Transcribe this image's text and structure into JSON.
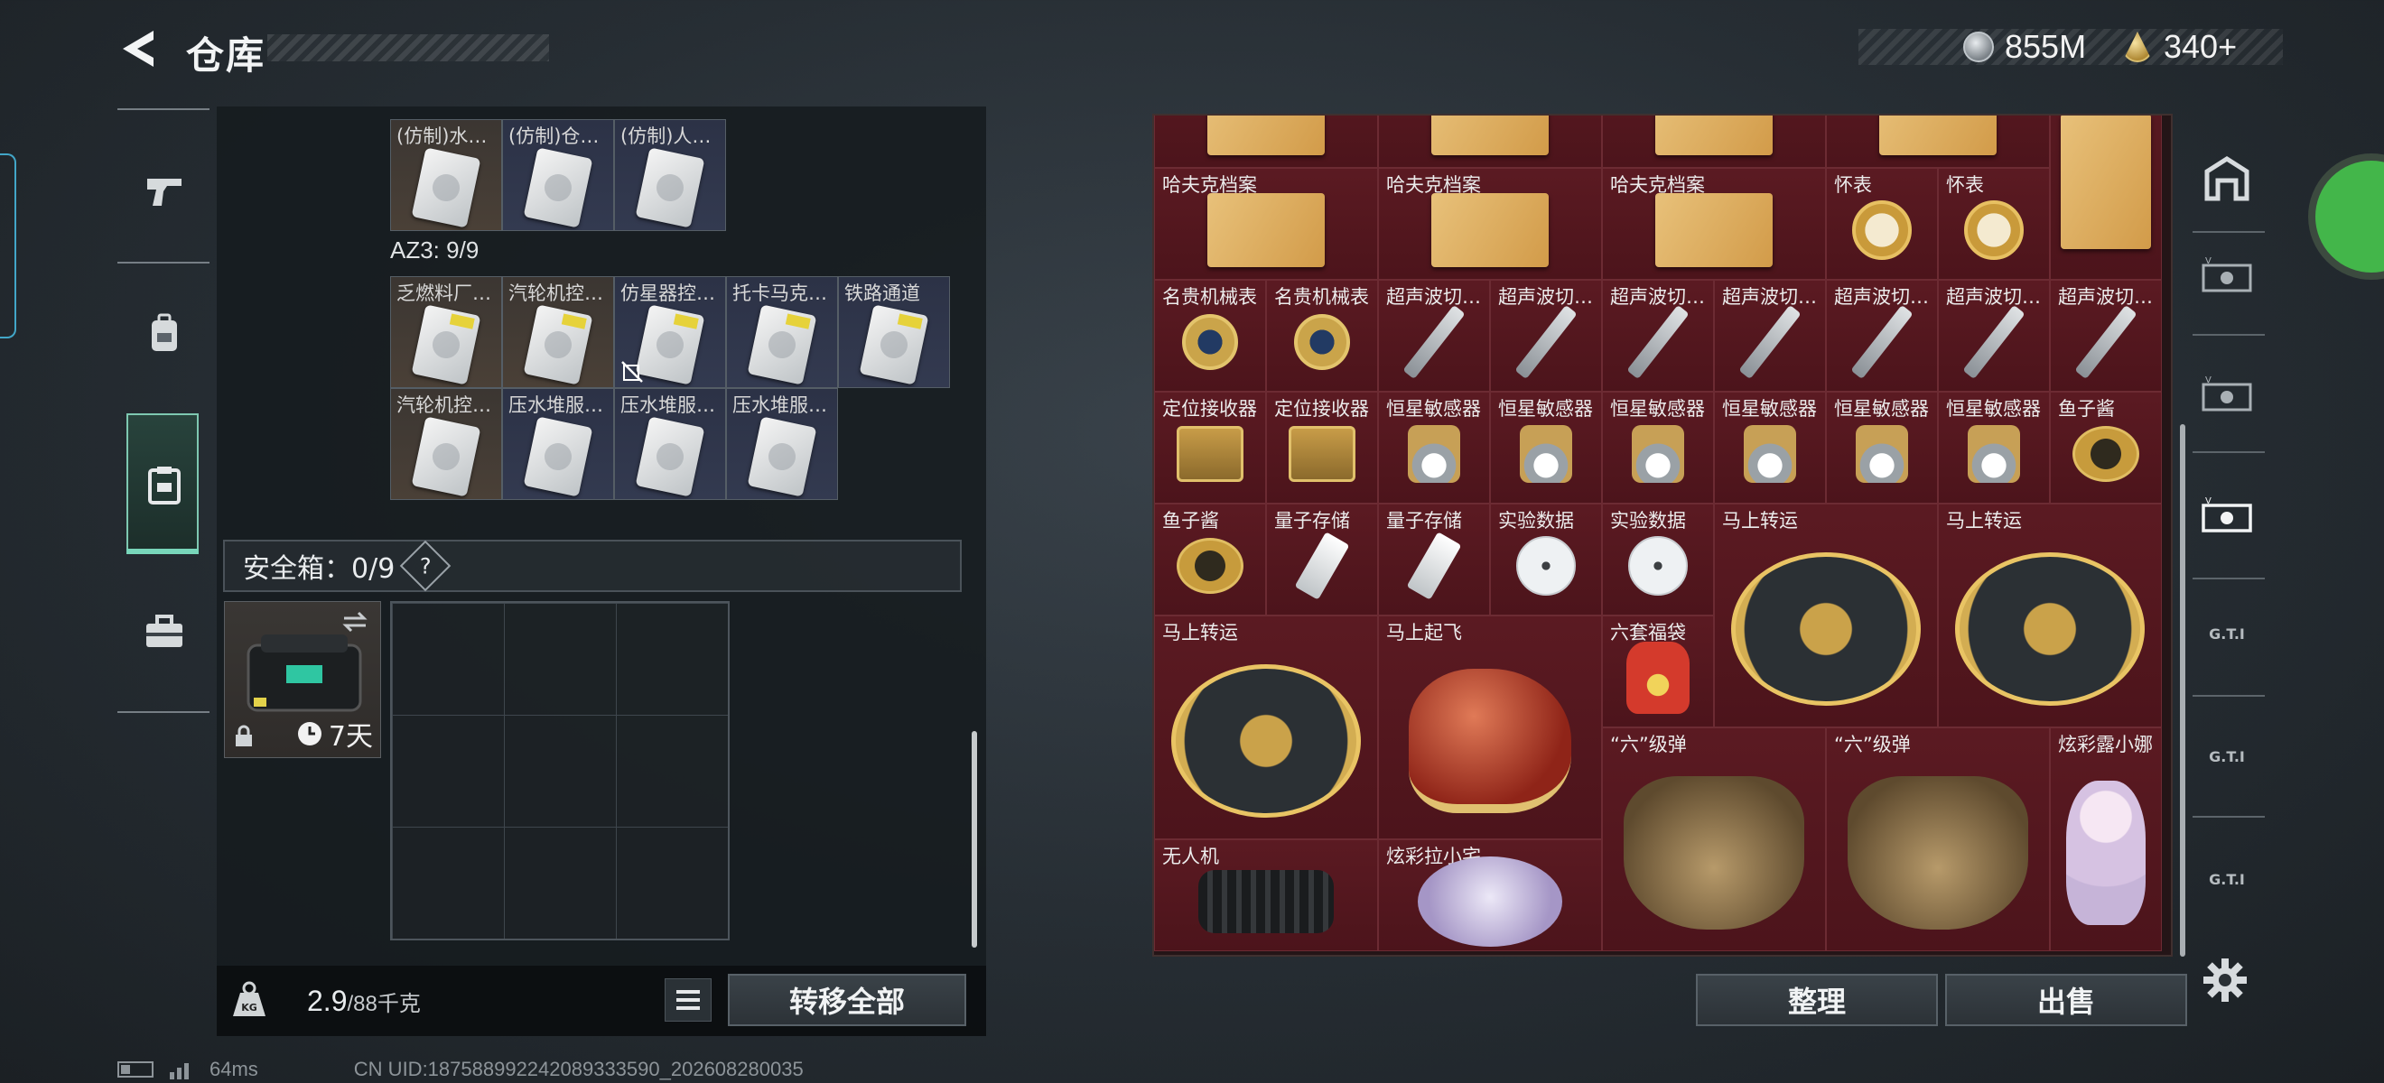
{
  "header": {
    "title": "仓库"
  },
  "currency": [
    {
      "icon": "silver-coin-icon",
      "value": "855M"
    },
    {
      "icon": "gold-triangle-coin-icon",
      "value": "340+"
    }
  ],
  "left_rail": [
    {
      "icon": "pistol-icon"
    },
    {
      "icon": "backpack-icon"
    },
    {
      "icon": "container-icon",
      "active": true
    },
    {
      "icon": "toolbox-icon"
    }
  ],
  "left_panel": {
    "top_row": [
      "(仿制)水…",
      "(仿制)仓…",
      "(仿制)人…"
    ],
    "section_label": "AZ3: 9/9",
    "az_rows": [
      [
        "乏燃料厂…",
        "汽轮机控…",
        "仿星器控…",
        "托卡马克…",
        "铁路通道"
      ],
      [
        "汽轮机控…",
        "压水堆服…",
        "压水堆服…",
        "压水堆服…"
      ]
    ],
    "safe_label": "安全箱：0/9",
    "help": "?",
    "safebox_timer": "7天",
    "weight_value": "2.9",
    "weight_max": "/88千克",
    "transfer_all": "转移全部"
  },
  "right_panel": {
    "rows": [
      [
        "哈夫克档案",
        "哈夫克档案",
        "哈夫克档案",
        "怀表",
        "怀表"
      ],
      [
        "名贵机械表",
        "名贵机械表",
        "超声波切…",
        "超声波切…",
        "超声波切…",
        "超声波切…",
        "超声波切…",
        "超声波切…",
        "超声波切…"
      ],
      [
        "定位接收器",
        "定位接收器",
        "恒星敏感器",
        "恒星敏感器",
        "恒星敏感器",
        "恒星敏感器",
        "恒星敏感器",
        "恒星敏感器",
        "鱼子酱"
      ],
      [
        "鱼子酱",
        "量子存储",
        "量子存储",
        "实验数据",
        "实验数据",
        "马上转运",
        "马上转运"
      ],
      [
        "马上转运",
        "马上起飞",
        "六套福袋",
        "“六”级弹",
        "“六”级弹",
        "炫彩露小娜"
      ],
      [
        "无人机",
        "炫彩拉小宅"
      ]
    ],
    "sort": "整理",
    "sell": "出售"
  },
  "right_tabs": [
    "",
    "",
    "",
    "",
    "G.T.I",
    "G.T.I",
    "G.T.I"
  ],
  "footer": {
    "ping": "64ms",
    "uid": "CN UID:187588992242089333590_202608280035"
  },
  "colors": {
    "accent": "#78d6ba",
    "item_bg": "#5b1a22"
  }
}
